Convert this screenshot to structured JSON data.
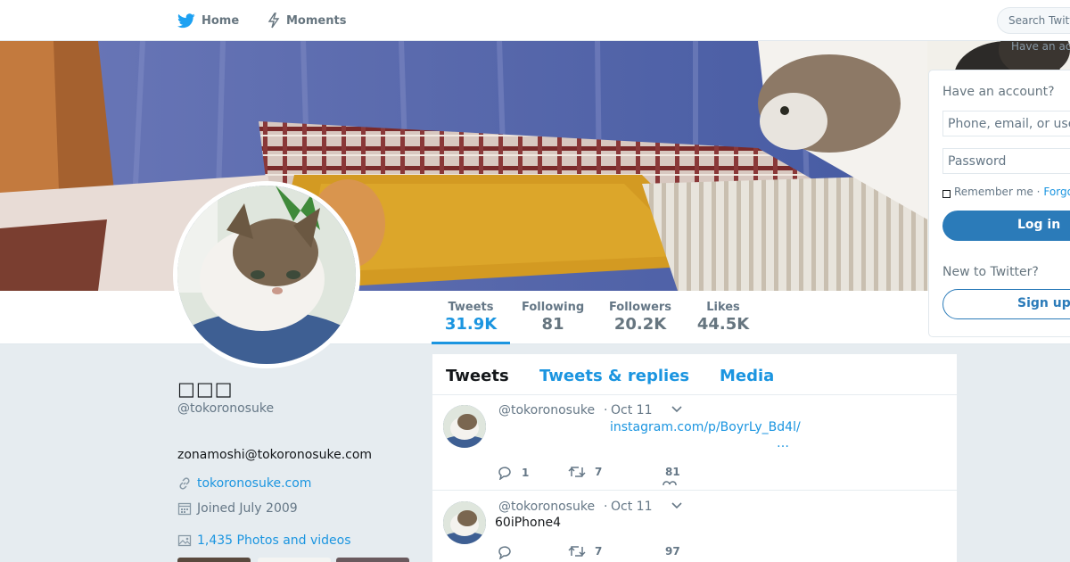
{
  "nav": {
    "home_label": "Home",
    "moments_label": "Moments",
    "search_placeholder": "Search Twitter",
    "have_account_small": "Have an account?"
  },
  "profile": {
    "name": "□□□",
    "handle": "@tokoronosuke",
    "bio": "zonamoshi@tokoronosuke.com",
    "url": "tokoronosuke.com",
    "joined": "Joined July 2009",
    "photos": "1,435 Photos and videos"
  },
  "stats": {
    "tweets_label": "Tweets",
    "tweets_value": "31.9K",
    "following_label": "Following",
    "following_value": "81",
    "followers_label": "Followers",
    "followers_value": "20.2K",
    "likes_label": "Likes",
    "likes_value": "44.5K"
  },
  "tabs": {
    "tweets": "Tweets",
    "replies": "Tweets & replies",
    "media": "Media"
  },
  "tweets": [
    {
      "handle": "@tokoronosuke",
      "dot": "·",
      "date": "Oct 11",
      "link": "instagram.com/p/BoyrLy_Bd4l/",
      "ellipsis": "…",
      "replies": "1",
      "retweets": "7",
      "likes": "81"
    },
    {
      "handle": "@tokoronosuke",
      "dot": "·",
      "date": "Oct 11",
      "text": "60iPhone4",
      "replies": "",
      "retweets": "7",
      "likes": "97"
    }
  ],
  "login": {
    "title": "Have an account?",
    "username_placeholder": "Phone, email, or username",
    "password_placeholder": "Password",
    "remember_label": "Remember me ·",
    "forgot_label": "Forgot password?",
    "login_button": "Log in",
    "new_label": "New to Twitter?",
    "signup_button": "Sign up"
  },
  "colors": {
    "accent": "#1b95e0",
    "button": "#2b7bb9",
    "background": "#e6ecf0"
  }
}
